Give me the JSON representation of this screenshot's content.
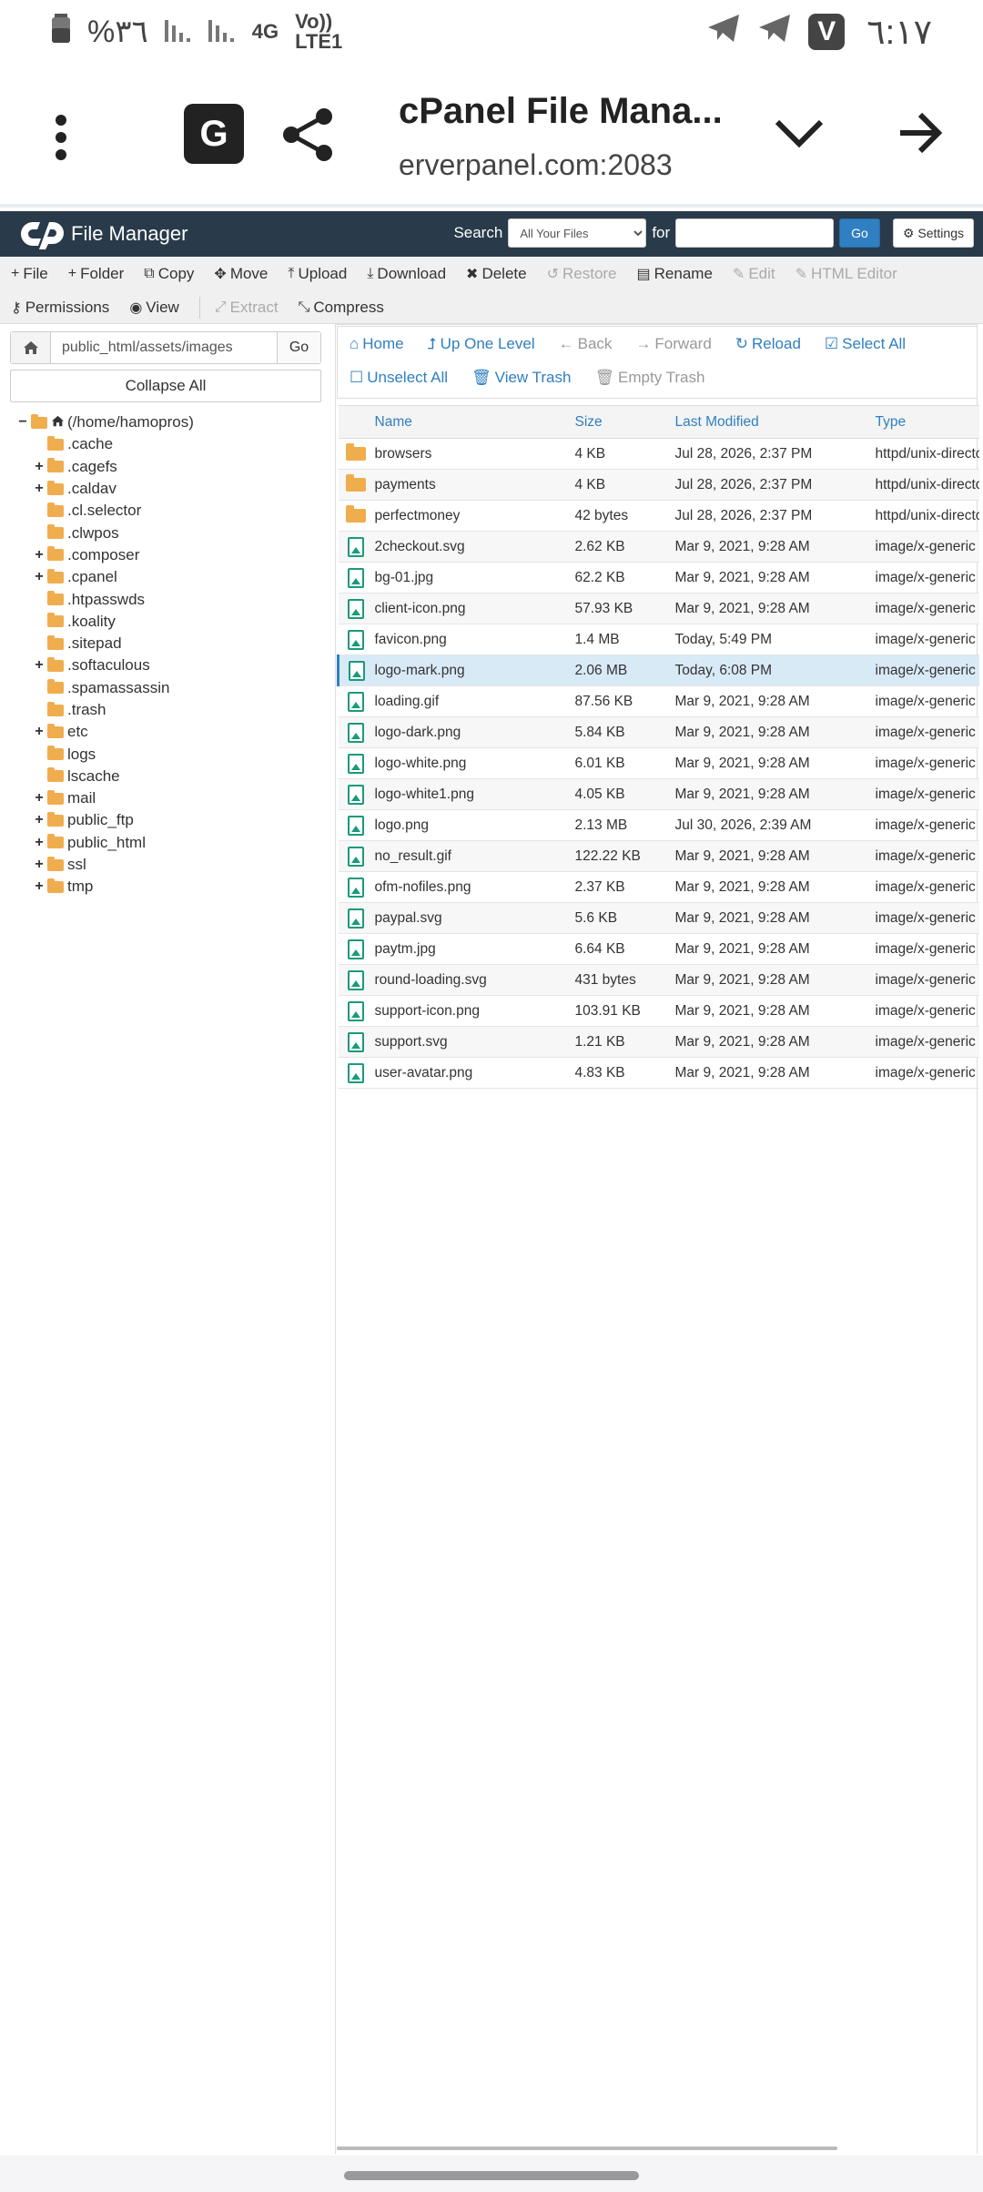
{
  "status": {
    "battery": "%٣٦",
    "network": "4G",
    "volte": "Vo)) LTE1",
    "time": "٦:١٧"
  },
  "browser": {
    "page_title": "cPanel File Mana...",
    "url": "erverpanel.com:2083"
  },
  "header": {
    "app_title": "File Manager",
    "search_label": "Search",
    "search_scope": "All Your Files",
    "for_label": "for",
    "go_label": "Go",
    "settings_label": "Settings"
  },
  "toolbar": {
    "row1": [
      {
        "label": "File",
        "icon": "plus-icon",
        "disabled": false
      },
      {
        "label": "Folder",
        "icon": "plus-icon",
        "disabled": false
      },
      {
        "label": "Copy",
        "icon": "copy-icon",
        "disabled": false
      },
      {
        "label": "Move",
        "icon": "move-icon",
        "disabled": false
      },
      {
        "label": "Upload",
        "icon": "upload-icon",
        "disabled": false
      },
      {
        "label": "Download",
        "icon": "download-icon",
        "disabled": false
      },
      {
        "label": "Delete",
        "icon": "close-icon",
        "disabled": false
      },
      {
        "label": "Restore",
        "icon": "undo-icon",
        "disabled": true
      },
      {
        "label": "Rename",
        "icon": "file-icon",
        "disabled": false
      },
      {
        "label": "Edit",
        "icon": "pencil-icon",
        "disabled": true
      },
      {
        "label": "HTML Editor",
        "icon": "edit-icon",
        "disabled": true
      }
    ],
    "row2": [
      {
        "label": "Permissions",
        "icon": "key-icon",
        "disabled": false
      },
      {
        "label": "View",
        "icon": "eye-icon",
        "disabled": false
      },
      {
        "label": "Extract",
        "icon": "expand-icon",
        "disabled": true
      },
      {
        "label": "Compress",
        "icon": "compress-icon",
        "disabled": false
      }
    ]
  },
  "left": {
    "path_value": "public_html/assets/images",
    "go_label": "Go",
    "collapse_label": "Collapse All",
    "tree": [
      {
        "label": "(/home/hamopros)",
        "toggle": "−",
        "indent": 0,
        "home": true
      },
      {
        "label": ".cache",
        "toggle": "",
        "indent": 1
      },
      {
        "label": ".cagefs",
        "toggle": "+",
        "indent": 1
      },
      {
        "label": ".caldav",
        "toggle": "+",
        "indent": 1
      },
      {
        "label": ".cl.selector",
        "toggle": "",
        "indent": 1
      },
      {
        "label": ".clwpos",
        "toggle": "",
        "indent": 1
      },
      {
        "label": ".composer",
        "toggle": "+",
        "indent": 1
      },
      {
        "label": ".cpanel",
        "toggle": "+",
        "indent": 1
      },
      {
        "label": ".htpasswds",
        "toggle": "",
        "indent": 1
      },
      {
        "label": ".koality",
        "toggle": "",
        "indent": 1
      },
      {
        "label": ".sitepad",
        "toggle": "",
        "indent": 1
      },
      {
        "label": ".softaculous",
        "toggle": "+",
        "indent": 1
      },
      {
        "label": ".spamassassin",
        "toggle": "",
        "indent": 1
      },
      {
        "label": ".trash",
        "toggle": "",
        "indent": 1
      },
      {
        "label": "etc",
        "toggle": "+",
        "indent": 1
      },
      {
        "label": "logs",
        "toggle": "",
        "indent": 1
      },
      {
        "label": "lscache",
        "toggle": "",
        "indent": 1
      },
      {
        "label": "mail",
        "toggle": "+",
        "indent": 1
      },
      {
        "label": "public_ftp",
        "toggle": "+",
        "indent": 1
      },
      {
        "label": "public_html",
        "toggle": "+",
        "indent": 1
      },
      {
        "label": "ssl",
        "toggle": "+",
        "indent": 1
      },
      {
        "label": "tmp",
        "toggle": "+",
        "indent": 1
      }
    ]
  },
  "actions": {
    "row1": [
      {
        "label": "Home",
        "icon": "home-icon",
        "disabled": false
      },
      {
        "label": "Up One Level",
        "icon": "level-up-icon",
        "disabled": false
      },
      {
        "label": "Back",
        "icon": "arrow-left-icon",
        "disabled": true
      },
      {
        "label": "Forward",
        "icon": "arrow-right-icon",
        "disabled": true
      },
      {
        "label": "Reload",
        "icon": "refresh-icon",
        "disabled": false
      },
      {
        "label": "Select All",
        "icon": "checkbox-icon",
        "disabled": false
      }
    ],
    "row2": [
      {
        "label": "Unselect All",
        "icon": "square-icon",
        "disabled": false
      },
      {
        "label": "View Trash",
        "icon": "trash-icon",
        "disabled": false
      },
      {
        "label": "Empty Trash",
        "icon": "trash-icon",
        "disabled": true
      }
    ]
  },
  "files": {
    "columns": [
      "Name",
      "Size",
      "Last Modified",
      "Type"
    ],
    "rows": [
      {
        "name": "browsers",
        "size": "4 KB",
        "modified": "Jul 28, 2026, 2:37 PM",
        "type": "httpd/unix-directory",
        "kind": "folder"
      },
      {
        "name": "payments",
        "size": "4 KB",
        "modified": "Jul 28, 2026, 2:37 PM",
        "type": "httpd/unix-directory",
        "kind": "folder"
      },
      {
        "name": "perfectmoney",
        "size": "42 bytes",
        "modified": "Jul 28, 2026, 2:37 PM",
        "type": "httpd/unix-directory",
        "kind": "folder"
      },
      {
        "name": "2checkout.svg",
        "size": "2.62 KB",
        "modified": "Mar 9, 2021, 9:28 AM",
        "type": "image/x-generic",
        "kind": "image"
      },
      {
        "name": "bg-01.jpg",
        "size": "62.2 KB",
        "modified": "Mar 9, 2021, 9:28 AM",
        "type": "image/x-generic",
        "kind": "image"
      },
      {
        "name": "client-icon.png",
        "size": "57.93 KB",
        "modified": "Mar 9, 2021, 9:28 AM",
        "type": "image/x-generic",
        "kind": "image"
      },
      {
        "name": "favicon.png",
        "size": "1.4 MB",
        "modified": "Today, 5:49 PM",
        "type": "image/x-generic",
        "kind": "image"
      },
      {
        "name": "logo-mark.png",
        "size": "2.06 MB",
        "modified": "Today, 6:08 PM",
        "type": "image/x-generic",
        "kind": "image",
        "selected": true
      },
      {
        "name": "loading.gif",
        "size": "87.56 KB",
        "modified": "Mar 9, 2021, 9:28 AM",
        "type": "image/x-generic",
        "kind": "image"
      },
      {
        "name": "logo-dark.png",
        "size": "5.84 KB",
        "modified": "Mar 9, 2021, 9:28 AM",
        "type": "image/x-generic",
        "kind": "image"
      },
      {
        "name": "logo-white.png",
        "size": "6.01 KB",
        "modified": "Mar 9, 2021, 9:28 AM",
        "type": "image/x-generic",
        "kind": "image"
      },
      {
        "name": "logo-white1.png",
        "size": "4.05 KB",
        "modified": "Mar 9, 2021, 9:28 AM",
        "type": "image/x-generic",
        "kind": "image"
      },
      {
        "name": "logo.png",
        "size": "2.13 MB",
        "modified": "Jul 30, 2026, 2:39 AM",
        "type": "image/x-generic",
        "kind": "image"
      },
      {
        "name": "no_result.gif",
        "size": "122.22 KB",
        "modified": "Mar 9, 2021, 9:28 AM",
        "type": "image/x-generic",
        "kind": "image"
      },
      {
        "name": "ofm-nofiles.png",
        "size": "2.37 KB",
        "modified": "Mar 9, 2021, 9:28 AM",
        "type": "image/x-generic",
        "kind": "image"
      },
      {
        "name": "paypal.svg",
        "size": "5.6 KB",
        "modified": "Mar 9, 2021, 9:28 AM",
        "type": "image/x-generic",
        "kind": "image"
      },
      {
        "name": "paytm.jpg",
        "size": "6.64 KB",
        "modified": "Mar 9, 2021, 9:28 AM",
        "type": "image/x-generic",
        "kind": "image"
      },
      {
        "name": "round-loading.svg",
        "size": "431 bytes",
        "modified": "Mar 9, 2021, 9:28 AM",
        "type": "image/x-generic",
        "kind": "image"
      },
      {
        "name": "support-icon.png",
        "size": "103.91 KB",
        "modified": "Mar 9, 2021, 9:28 AM",
        "type": "image/x-generic",
        "kind": "image"
      },
      {
        "name": "support.svg",
        "size": "1.21 KB",
        "modified": "Mar 9, 2021, 9:28 AM",
        "type": "image/x-generic",
        "kind": "image"
      },
      {
        "name": "user-avatar.png",
        "size": "4.83 KB",
        "modified": "Mar 9, 2021, 9:28 AM",
        "type": "image/x-generic",
        "kind": "image"
      }
    ]
  },
  "colors": {
    "header_bg": "#293a4a",
    "link_blue": "#2f7fc1",
    "folder": "#f0ad4e",
    "image_icon": "#1a9a7a",
    "selected_row": "#d9eaf7"
  }
}
